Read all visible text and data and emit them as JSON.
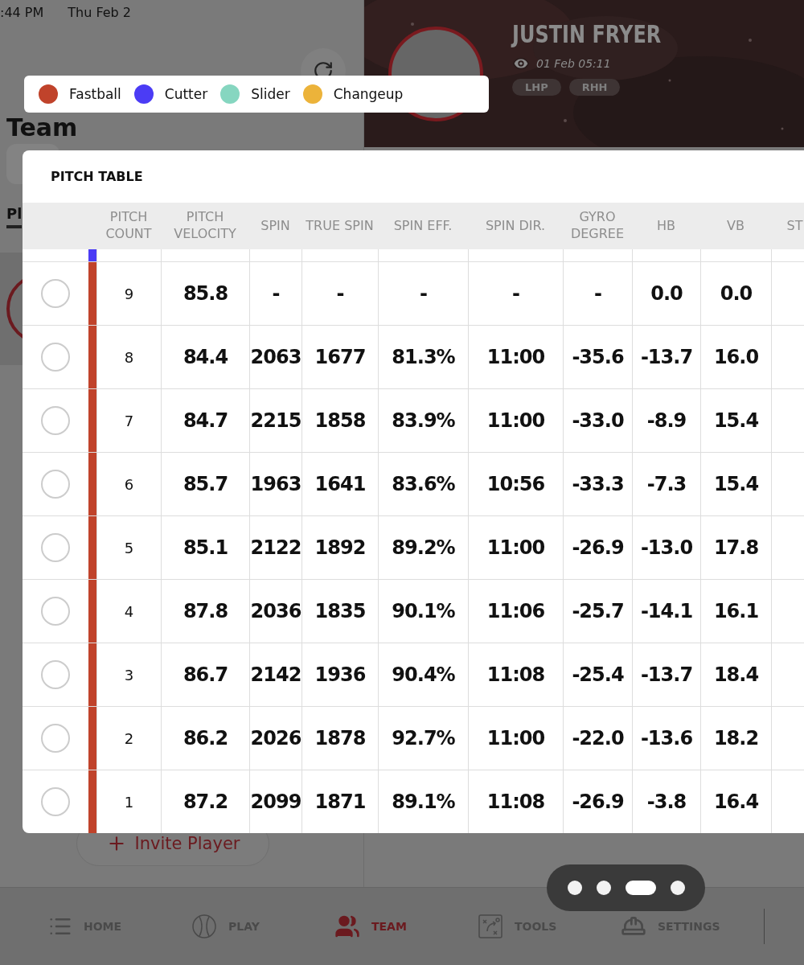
{
  "status_bar": {
    "time": ":44 PM",
    "date": "Thu Feb 2"
  },
  "team_panel": {
    "title": "Team",
    "tab": "Pl",
    "invite_button": "Invite Player"
  },
  "player_header": {
    "name": "JUSTIN FRYER",
    "seen": "01 Feb 05:11",
    "tags": [
      "LHP",
      "RHH"
    ]
  },
  "legend": [
    {
      "label": "Fastball",
      "color": "#c0432b"
    },
    {
      "label": "Cutter",
      "color": "#4b3cf5"
    },
    {
      "label": "Slider",
      "color": "#86d6c0"
    },
    {
      "label": "Changeup",
      "color": "#ecb33a"
    }
  ],
  "pitch_table": {
    "title": "PITCH TABLE",
    "columns": [
      "PITCH COUNT",
      "PITCH VELOCITY",
      "SPIN",
      "TRUE SPIN",
      "SPIN EFF.",
      "SPIN DIR.",
      "GYRO DEGREE",
      "HB",
      "VB",
      "ST"
    ],
    "rows": [
      {
        "color": "#4b3cf5",
        "cells": []
      },
      {
        "selected": false,
        "color": "#c0432b",
        "cells": [
          "9",
          "85.8",
          "-",
          "-",
          "-",
          "-",
          "-",
          "0.0",
          "0.0"
        ]
      },
      {
        "selected": false,
        "color": "#c0432b",
        "cells": [
          "8",
          "84.4",
          "2063",
          "1677",
          "81.3%",
          "11:00",
          "-35.6",
          "-13.7",
          "16.0"
        ]
      },
      {
        "selected": false,
        "color": "#c0432b",
        "cells": [
          "7",
          "84.7",
          "2215",
          "1858",
          "83.9%",
          "11:00",
          "-33.0",
          "-8.9",
          "15.4"
        ]
      },
      {
        "selected": false,
        "color": "#c0432b",
        "cells": [
          "6",
          "85.7",
          "1963",
          "1641",
          "83.6%",
          "10:56",
          "-33.3",
          "-7.3",
          "15.4"
        ]
      },
      {
        "selected": false,
        "color": "#c0432b",
        "cells": [
          "5",
          "85.1",
          "2122",
          "1892",
          "89.2%",
          "11:00",
          "-26.9",
          "-13.0",
          "17.8"
        ]
      },
      {
        "selected": false,
        "color": "#c0432b",
        "cells": [
          "4",
          "87.8",
          "2036",
          "1835",
          "90.1%",
          "11:06",
          "-25.7",
          "-14.1",
          "16.1"
        ]
      },
      {
        "selected": false,
        "color": "#c0432b",
        "cells": [
          "3",
          "86.7",
          "2142",
          "1936",
          "90.4%",
          "11:08",
          "-25.4",
          "-13.7",
          "18.4"
        ]
      },
      {
        "selected": false,
        "color": "#c0432b",
        "cells": [
          "2",
          "86.2",
          "2026",
          "1878",
          "92.7%",
          "11:00",
          "-22.0",
          "-13.6",
          "18.2"
        ]
      },
      {
        "selected": false,
        "color": "#c0432b",
        "cells": [
          "1",
          "87.2",
          "2099",
          "1871",
          "89.1%",
          "11:08",
          "-26.9",
          "-3.8",
          "16.4"
        ]
      }
    ]
  },
  "pager": [
    {
      "selected": false
    },
    {
      "selected": false
    },
    {
      "selected": true
    },
    {
      "selected": false
    }
  ],
  "nav": [
    {
      "label": "HOME",
      "kind": "home",
      "selected": false
    },
    {
      "label": "PLAY",
      "kind": "play",
      "selected": false
    },
    {
      "label": "TEAM",
      "kind": "team",
      "selected": true
    },
    {
      "label": "TOOLS",
      "kind": "tools",
      "selected": false
    },
    {
      "label": "SETTINGS",
      "kind": "settings",
      "selected": false
    }
  ]
}
